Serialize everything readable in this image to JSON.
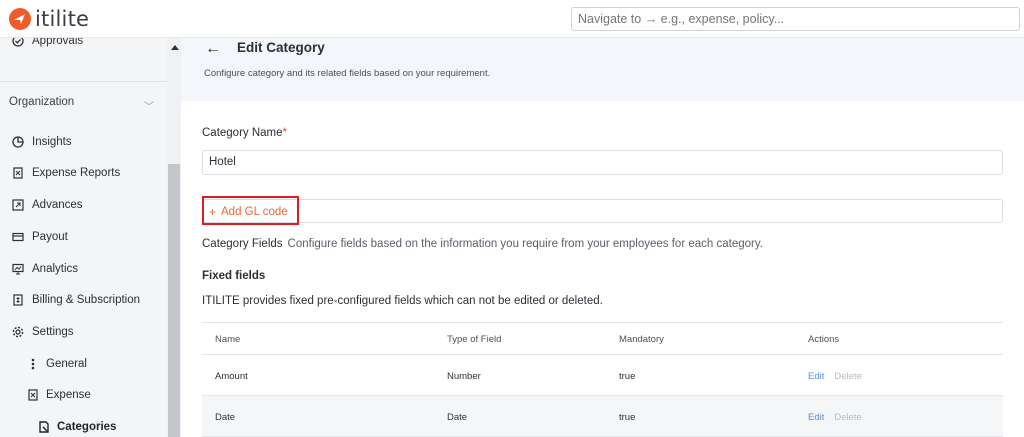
{
  "app": {
    "logo_text": "itilite"
  },
  "search": {
    "placeholder": "Navigate to → e.g., expense, policy..."
  },
  "sidebar": {
    "approvals": "Approvals",
    "organization": "Organization",
    "items": [
      {
        "label": "Insights",
        "icon": "pie-chart-icon"
      },
      {
        "label": "Expense Reports",
        "icon": "receipt-icon"
      },
      {
        "label": "Advances",
        "icon": "advance-icon"
      },
      {
        "label": "Payout",
        "icon": "card-icon"
      },
      {
        "label": "Analytics",
        "icon": "analytics-icon"
      },
      {
        "label": "Billing & Subscription",
        "icon": "billing-icon"
      },
      {
        "label": "Settings",
        "icon": "gear-icon"
      }
    ],
    "sub_items": [
      {
        "label": "General",
        "icon": "kebab-icon"
      },
      {
        "label": "Expense",
        "icon": "receipt-icon"
      }
    ],
    "active_sub": {
      "label": "Categories",
      "icon": "category-icon"
    }
  },
  "header": {
    "title": "Edit Category",
    "subtitle": "Configure category and its related fields based on your requirement."
  },
  "form": {
    "category_name_label": "Category Name",
    "required_mark": "*",
    "category_name_value": "Hotel",
    "add_gl_plus": "+",
    "add_gl_label": "Add GL code",
    "category_fields_title": "Category Fields",
    "category_fields_desc": "Configure fields based on the information you require from your employees for each category.",
    "fixed_fields_title": "Fixed fields",
    "fixed_fields_desc": "ITILITE provides fixed pre-configured fields which can not be edited or deleted."
  },
  "table": {
    "headers": [
      "Name",
      "Type of Field",
      "Mandatory",
      "Actions"
    ],
    "rows": [
      {
        "name": "Amount",
        "type": "Number",
        "mandatory": "true",
        "edit": "Edit",
        "delete": "Delete"
      },
      {
        "name": "Date",
        "type": "Date",
        "mandatory": "true",
        "edit": "Edit",
        "delete": "Delete"
      }
    ]
  },
  "colors": {
    "accent": "#e8673c",
    "brand": "#f15a29",
    "highlight": "#e01b24",
    "link": "#5b8fd6"
  }
}
